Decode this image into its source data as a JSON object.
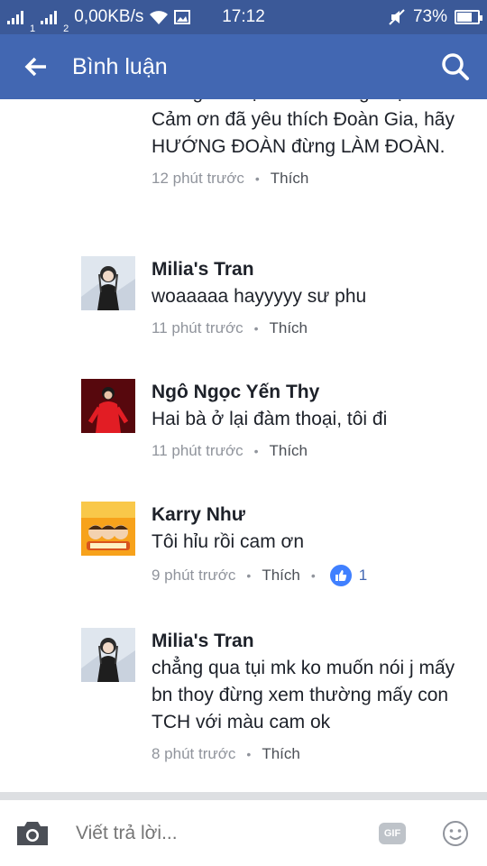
{
  "status_bar": {
    "carrier1": "1",
    "carrier2": "2",
    "speed": "0,00KB/s",
    "time": "17:12",
    "battery": "73%",
    "battery_level": 0.73
  },
  "app_bar": {
    "title": "Bình luận",
    "back_icon": "arrow-left-icon",
    "search_icon": "search-icon"
  },
  "comments": [
    {
      "name": "",
      "text": "chúng tôi một mình chống chọi.\nCảm ơn đã yêu thích Đoàn Gia, hãy HƯỚNG ĐOÀN đừng LÀM ĐOÀN.",
      "time": "12 phút trước",
      "like": "Thích"
    },
    {
      "name": "Milia's Tran",
      "text": "woaaaaa hayyyyy sư phu",
      "time": "11 phút trước",
      "like": "Thích"
    },
    {
      "name": "Ngô Ngọc Yến Thy",
      "text": "Hai bà ở lại đàm thoại, tôi đi",
      "time": "11 phút trước",
      "like": "Thích"
    },
    {
      "name": "Karry Như",
      "text": "Tôi hỉu rồi cam ơn",
      "time": "9 phút trước",
      "like": "Thích",
      "reaction_count": "1"
    },
    {
      "name": "Milia's Tran",
      "text": "chẳng qua tụi mk ko muốn nói j mấy bn thoy đừng xem thường mấy con TCH với màu cam ok",
      "time": "8 phút trước",
      "like": "Thích"
    }
  ],
  "composer": {
    "placeholder": "Viết trả lời...",
    "gif_label": "GIF"
  },
  "colors": {
    "status_bar": "#3b5998",
    "app_bar": "#4267b2",
    "like_reaction": "#4080ff"
  }
}
